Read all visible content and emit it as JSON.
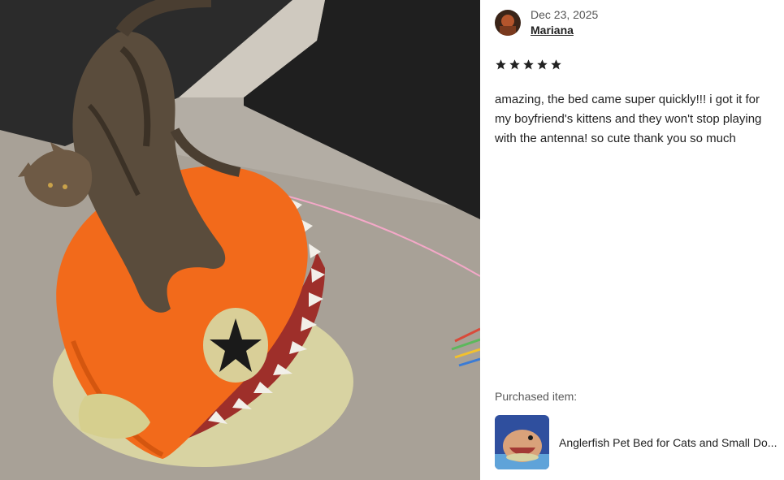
{
  "review": {
    "date": "Dec 23, 2025",
    "reviewer_name": "Mariana",
    "rating": 5,
    "star_icon": "star-icon",
    "text": "amazing, the bed came super quickly!!! i got it for my boyfriend's kittens and they won't stop playing with the antenna! so cute thank you so much"
  },
  "purchase": {
    "label": "Purchased item:",
    "item_title": "Anglerfish Pet Bed for Cats and Small Do..."
  },
  "colors": {
    "text": "#222222",
    "muted": "#595959",
    "bed_orange": "#f26a1b"
  }
}
